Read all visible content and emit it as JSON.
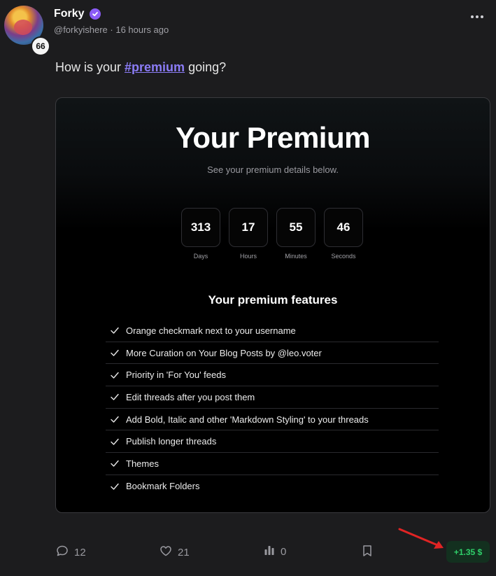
{
  "author": {
    "name": "Forky",
    "handle": "@forkyishere",
    "time": "16 hours ago",
    "level": "66"
  },
  "post": {
    "prefix": "How is your ",
    "hashtag": "#premium",
    "suffix": " going?"
  },
  "premium_card": {
    "title": "Your Premium",
    "subtitle": "See your premium details below.",
    "countdown": [
      {
        "value": "313",
        "label": "Days"
      },
      {
        "value": "17",
        "label": "Hours"
      },
      {
        "value": "55",
        "label": "Minutes"
      },
      {
        "value": "46",
        "label": "Seconds"
      }
    ],
    "features_title": "Your premium features",
    "features": [
      "Orange checkmark next to your username",
      "More Curation on Your Blog Posts by @leo.voter",
      "Priority in 'For You' feeds",
      "Edit threads after you post them",
      "Add Bold, Italic and other 'Markdown Styling' to your threads",
      "Publish longer threads",
      "Themes",
      "Bookmark Folders"
    ]
  },
  "actions": {
    "comments": "12",
    "likes": "21",
    "views": "0",
    "reward": "+1.35 $"
  },
  "icons": {
    "verified": "verified-badge-icon",
    "more": "more-options-icon",
    "comment": "comment-icon",
    "like": "heart-icon",
    "views": "stats-bar-icon",
    "bookmark": "bookmark-icon",
    "check": "check-icon"
  },
  "colors": {
    "accent": "#8b5cf6",
    "hashtag": "#8b7cf6",
    "reward_text": "#2fd06a",
    "reward_bg": "#13301f",
    "arrow": "#e02424"
  }
}
